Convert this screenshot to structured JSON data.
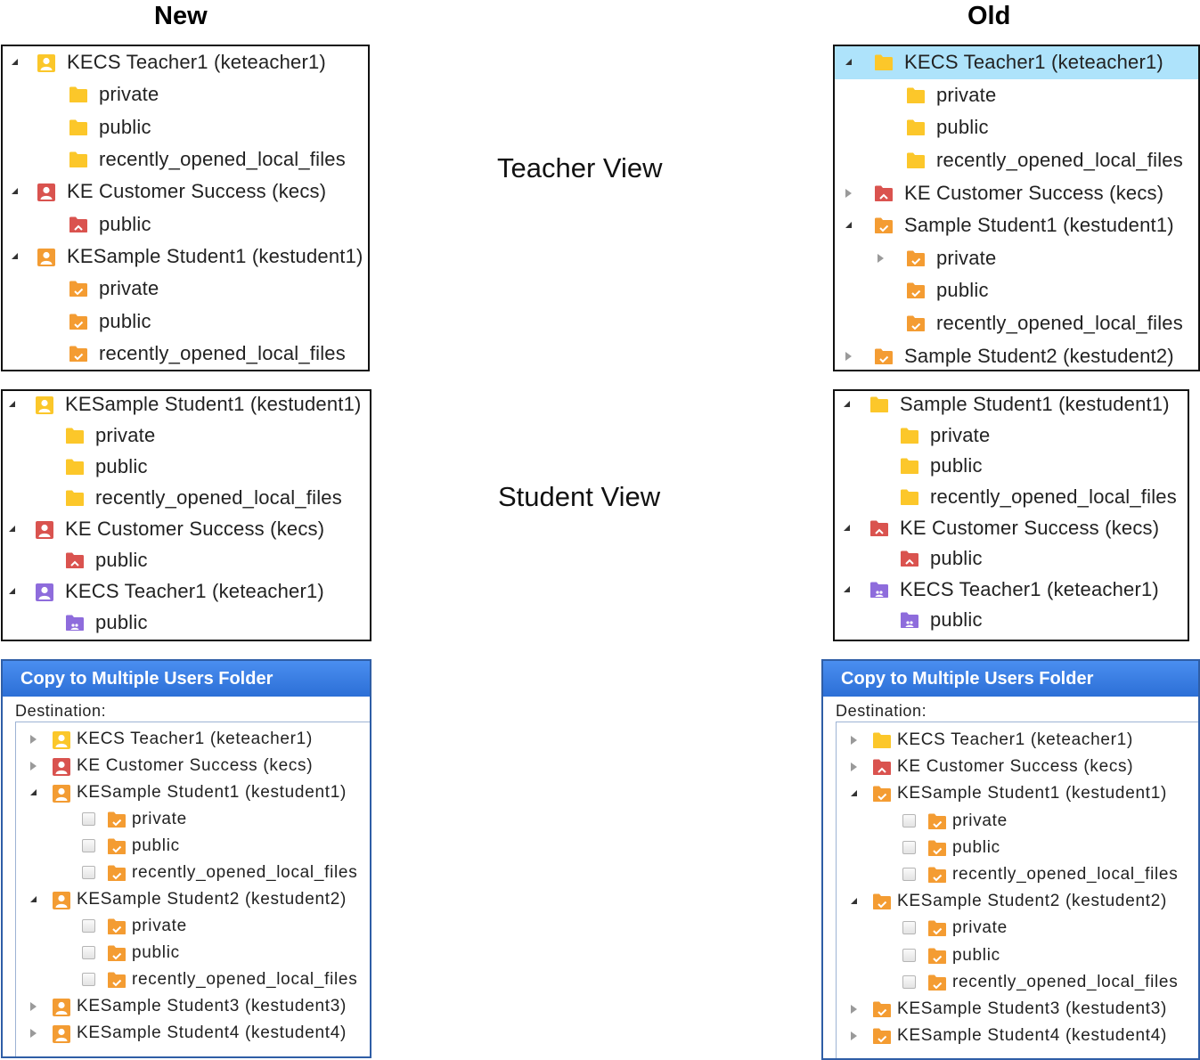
{
  "headers": {
    "new": "New",
    "old": "Old"
  },
  "labels": {
    "teacher_view": "Teacher View",
    "student_view": "Student View"
  },
  "colors": {
    "yellow": "#fbc72a",
    "red": "#d9534f",
    "orange": "#f39c33",
    "purple": "#8e6cdc",
    "selection": "#aee3fb",
    "dialog_header": "#2c6fd6"
  },
  "new_teacher": {
    "rows": [
      {
        "label": "KECS Teacher1 (keteacher1)",
        "level": 0,
        "arrow": "open",
        "icon": "user-yellow"
      },
      {
        "label": "private",
        "level": 1,
        "icon": "folder-yellow"
      },
      {
        "label": "public",
        "level": 1,
        "icon": "folder-yellow"
      },
      {
        "label": "recently_opened_local_files",
        "level": 1,
        "icon": "folder-yellow"
      },
      {
        "label": "KE Customer Success (kecs)",
        "level": 0,
        "arrow": "open",
        "icon": "user-red"
      },
      {
        "label": "public",
        "level": 1,
        "icon": "folder-red"
      },
      {
        "label": "KESample Student1 (kestudent1)",
        "level": 0,
        "arrow": "open",
        "icon": "user-orange"
      },
      {
        "label": "private",
        "level": 1,
        "icon": "folder-orange"
      },
      {
        "label": "public",
        "level": 1,
        "icon": "folder-orange"
      },
      {
        "label": "recently_opened_local_files",
        "level": 1,
        "icon": "folder-orange"
      }
    ]
  },
  "old_teacher": {
    "rows": [
      {
        "label": "KECS Teacher1 (keteacher1)",
        "level": 0,
        "arrow": "open",
        "icon": "folder-yellow",
        "selected": true
      },
      {
        "label": "private",
        "level": 1,
        "icon": "folder-yellow"
      },
      {
        "label": "public",
        "level": 1,
        "icon": "folder-yellow"
      },
      {
        "label": "recently_opened_local_files",
        "level": 1,
        "icon": "folder-yellow"
      },
      {
        "label": "KE Customer Success (kecs)",
        "level": 0,
        "arrow": "closed",
        "icon": "folder-red"
      },
      {
        "label": "Sample Student1 (kestudent1)",
        "level": 0,
        "arrow": "open",
        "icon": "folder-orange"
      },
      {
        "label": "private",
        "level": 1,
        "arrow": "closed",
        "icon": "folder-orange"
      },
      {
        "label": "public",
        "level": 1,
        "icon": "folder-orange"
      },
      {
        "label": "recently_opened_local_files",
        "level": 1,
        "icon": "folder-orange"
      },
      {
        "label": "Sample Student2 (kestudent2)",
        "level": 0,
        "arrow": "closed",
        "icon": "folder-orange"
      }
    ]
  },
  "new_student": {
    "rows": [
      {
        "label": "KESample Student1 (kestudent1)",
        "level": 0,
        "arrow": "open",
        "icon": "user-yellow"
      },
      {
        "label": "private",
        "level": 1,
        "icon": "folder-yellow"
      },
      {
        "label": "public",
        "level": 1,
        "icon": "folder-yellow"
      },
      {
        "label": "recently_opened_local_files",
        "level": 1,
        "icon": "folder-yellow"
      },
      {
        "label": "KE Customer Success (kecs)",
        "level": 0,
        "arrow": "open",
        "icon": "user-red"
      },
      {
        "label": "public",
        "level": 1,
        "icon": "folder-red"
      },
      {
        "label": "KECS Teacher1 (keteacher1)",
        "level": 0,
        "arrow": "open",
        "icon": "user-purple"
      },
      {
        "label": "public",
        "level": 1,
        "icon": "folder-purple"
      }
    ]
  },
  "old_student": {
    "rows": [
      {
        "label": "Sample Student1 (kestudent1)",
        "level": 0,
        "arrow": "open",
        "icon": "folder-yellow"
      },
      {
        "label": "private",
        "level": 1,
        "icon": "folder-yellow"
      },
      {
        "label": "public",
        "level": 1,
        "icon": "folder-yellow"
      },
      {
        "label": "recently_opened_local_files",
        "level": 1,
        "icon": "folder-yellow"
      },
      {
        "label": "KE Customer Success (kecs)",
        "level": 0,
        "arrow": "open",
        "icon": "folder-red"
      },
      {
        "label": "public",
        "level": 1,
        "icon": "folder-red"
      },
      {
        "label": "KECS Teacher1 (keteacher1)",
        "level": 0,
        "arrow": "open",
        "icon": "folder-purple"
      },
      {
        "label": "public",
        "level": 1,
        "icon": "folder-purple"
      }
    ]
  },
  "new_dialog": {
    "title": "Copy to Multiple Users Folder",
    "destination_label": "Destination:",
    "rows": [
      {
        "label": "KECS Teacher1 (keteacher1)",
        "level": 0,
        "arrow": "closed",
        "icon": "user-yellow"
      },
      {
        "label": "KE Customer Success (kecs)",
        "level": 0,
        "arrow": "closed",
        "icon": "user-red"
      },
      {
        "label": "KESample Student1 (kestudent1)",
        "level": 0,
        "arrow": "open",
        "icon": "user-orange"
      },
      {
        "label": "private",
        "level": 1,
        "checkbox": true,
        "icon": "folder-orange"
      },
      {
        "label": "public",
        "level": 1,
        "checkbox": true,
        "icon": "folder-orange"
      },
      {
        "label": "recently_opened_local_files",
        "level": 1,
        "checkbox": true,
        "icon": "folder-orange"
      },
      {
        "label": "KESample Student2 (kestudent2)",
        "level": 0,
        "arrow": "open",
        "icon": "user-orange"
      },
      {
        "label": "private",
        "level": 1,
        "checkbox": true,
        "icon": "folder-orange"
      },
      {
        "label": "public",
        "level": 1,
        "checkbox": true,
        "icon": "folder-orange"
      },
      {
        "label": "recently_opened_local_files",
        "level": 1,
        "checkbox": true,
        "icon": "folder-orange"
      },
      {
        "label": "KESample Student3 (kestudent3)",
        "level": 0,
        "arrow": "closed",
        "icon": "user-orange"
      },
      {
        "label": "KESample Student4 (kestudent4)",
        "level": 0,
        "arrow": "closed",
        "icon": "user-orange"
      }
    ]
  },
  "old_dialog": {
    "title": "Copy to Multiple Users Folder",
    "destination_label": "Destination:",
    "rows": [
      {
        "label": "KECS Teacher1 (keteacher1)",
        "level": 0,
        "arrow": "closed",
        "icon": "folder-yellow"
      },
      {
        "label": "KE Customer Success (kecs)",
        "level": 0,
        "arrow": "closed",
        "icon": "folder-red"
      },
      {
        "label": "KESample Student1 (kestudent1)",
        "level": 0,
        "arrow": "open",
        "icon": "folder-orange"
      },
      {
        "label": "private",
        "level": 1,
        "checkbox": true,
        "icon": "folder-orange"
      },
      {
        "label": "public",
        "level": 1,
        "checkbox": true,
        "icon": "folder-orange"
      },
      {
        "label": "recently_opened_local_files",
        "level": 1,
        "checkbox": true,
        "icon": "folder-orange"
      },
      {
        "label": "KESample Student2 (kestudent2)",
        "level": 0,
        "arrow": "open",
        "icon": "folder-orange"
      },
      {
        "label": "private",
        "level": 1,
        "checkbox": true,
        "icon": "folder-orange"
      },
      {
        "label": "public",
        "level": 1,
        "checkbox": true,
        "icon": "folder-orange"
      },
      {
        "label": "recently_opened_local_files",
        "level": 1,
        "checkbox": true,
        "icon": "folder-orange"
      },
      {
        "label": "KESample Student3 (kestudent3)",
        "level": 0,
        "arrow": "closed",
        "icon": "folder-orange"
      },
      {
        "label": "KESample Student4 (kestudent4)",
        "level": 0,
        "arrow": "closed",
        "icon": "folder-orange"
      }
    ]
  }
}
